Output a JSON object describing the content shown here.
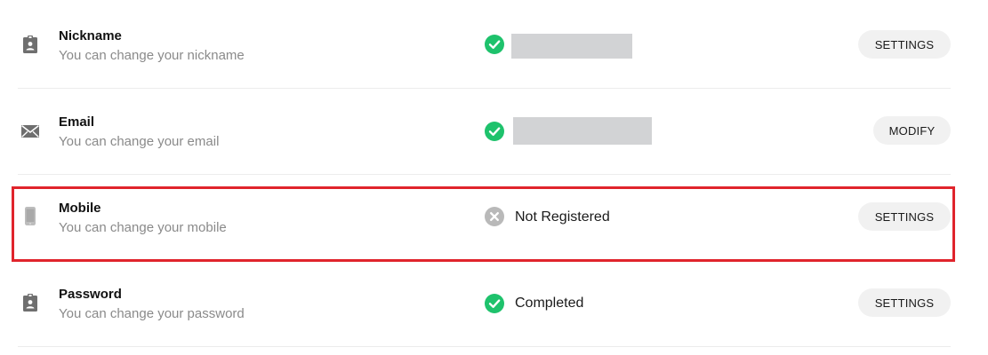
{
  "rows": [
    {
      "title": "Nickname",
      "description": "You can change your nickname",
      "status": "verified",
      "status_text": "",
      "button_label": "SETTINGS",
      "icon": "contact-badge-icon"
    },
    {
      "title": "Email",
      "description": "You can change your email",
      "status": "verified",
      "status_text": "",
      "button_label": "MODIFY",
      "icon": "envelope-icon"
    },
    {
      "title": "Mobile",
      "description": "You can change your mobile",
      "status": "not-registered",
      "status_text": "Not Registered",
      "button_label": "SETTINGS",
      "icon": "smartphone-icon"
    },
    {
      "title": "Password",
      "description": "You can change your password",
      "status": "verified",
      "status_text": "Completed",
      "button_label": "SETTINGS",
      "icon": "contact-badge-icon"
    }
  ],
  "colors": {
    "verified": "#1ec26c",
    "not_registered": "#b9b9b9",
    "highlight": "#e0242c",
    "masked": "#d2d3d5"
  }
}
